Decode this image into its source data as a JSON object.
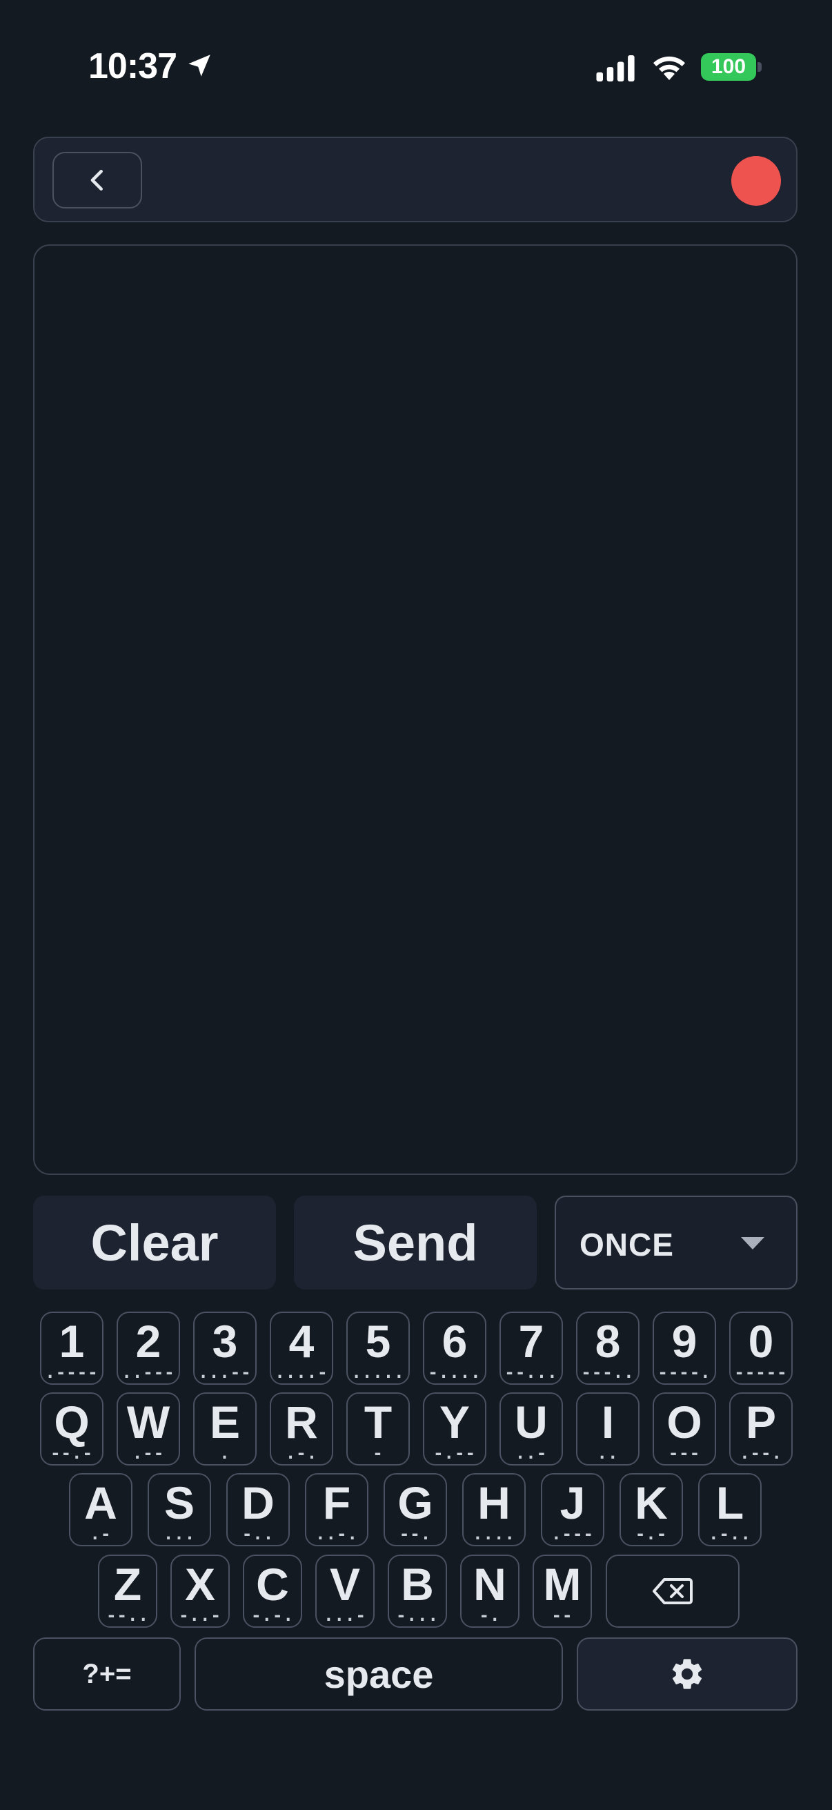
{
  "status": {
    "time": "10:37",
    "battery": "100",
    "battery_color": "#34c759",
    "icons": [
      "location-arrow-icon",
      "cellular-signal-icon",
      "wifi-icon",
      "battery-icon"
    ]
  },
  "top_bar": {
    "back_icon": "chevron-left-icon",
    "record_color": "#ef5350"
  },
  "message": {
    "text": ""
  },
  "actions": {
    "clear_label": "Clear",
    "send_label": "Send",
    "mode_value": "ONCE"
  },
  "keyboard": {
    "rows": [
      [
        {
          "char": "1",
          "morse": ".----"
        },
        {
          "char": "2",
          "morse": "..---"
        },
        {
          "char": "3",
          "morse": "...--"
        },
        {
          "char": "4",
          "morse": "....-"
        },
        {
          "char": "5",
          "morse": "....."
        },
        {
          "char": "6",
          "morse": "-...."
        },
        {
          "char": "7",
          "morse": "--..."
        },
        {
          "char": "8",
          "morse": "---.."
        },
        {
          "char": "9",
          "morse": "----."
        },
        {
          "char": "0",
          "morse": "-----"
        }
      ],
      [
        {
          "char": "Q",
          "morse": "--.-"
        },
        {
          "char": "W",
          "morse": ".--"
        },
        {
          "char": "E",
          "morse": "."
        },
        {
          "char": "R",
          "morse": ".-."
        },
        {
          "char": "T",
          "morse": "-"
        },
        {
          "char": "Y",
          "morse": "-.--"
        },
        {
          "char": "U",
          "morse": "..-"
        },
        {
          "char": "I",
          "morse": ".."
        },
        {
          "char": "O",
          "morse": "---"
        },
        {
          "char": "P",
          "morse": ".--."
        }
      ],
      [
        {
          "char": "A",
          "morse": ".-"
        },
        {
          "char": "S",
          "morse": "..."
        },
        {
          "char": "D",
          "morse": "-.."
        },
        {
          "char": "F",
          "morse": "..-."
        },
        {
          "char": "G",
          "morse": "--."
        },
        {
          "char": "H",
          "morse": "...."
        },
        {
          "char": "J",
          "morse": ".---"
        },
        {
          "char": "K",
          "morse": "-.-"
        },
        {
          "char": "L",
          "morse": ".-.."
        }
      ],
      [
        {
          "char": "Z",
          "morse": "--.."
        },
        {
          "char": "X",
          "morse": "-..-"
        },
        {
          "char": "C",
          "morse": "-.-."
        },
        {
          "char": "V",
          "morse": "...-"
        },
        {
          "char": "B",
          "morse": "-..."
        },
        {
          "char": "N",
          "morse": "-."
        },
        {
          "char": "M",
          "morse": "--"
        }
      ]
    ],
    "backspace_icon": "backspace-icon",
    "symbols_label": "?+=",
    "space_label": "space",
    "settings_icon": "gear-icon"
  }
}
